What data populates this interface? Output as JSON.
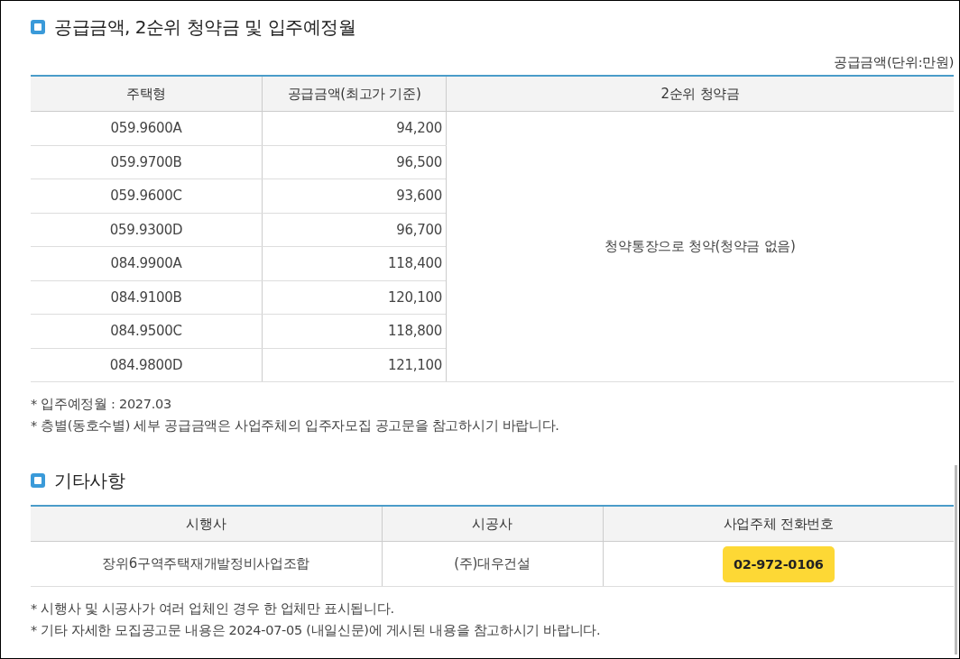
{
  "supply_section": {
    "title": "공급금액, 2순위 청약금 및 입주예정월",
    "unit_note": "공급금액(단위:만원)",
    "columns": [
      "주택형",
      "공급금액(최고가 기준)",
      "2순위 청약금"
    ],
    "rows": [
      {
        "type": "059.9600A",
        "price": "94,200"
      },
      {
        "type": "059.9700B",
        "price": "96,500"
      },
      {
        "type": "059.9600C",
        "price": "93,600"
      },
      {
        "type": "059.9300D",
        "price": "96,700"
      },
      {
        "type": "084.9900A",
        "price": "118,400"
      },
      {
        "type": "084.9100B",
        "price": "120,100"
      },
      {
        "type": "084.9500C",
        "price": "118,800"
      },
      {
        "type": "084.9800D",
        "price": "121,100"
      }
    ],
    "deposit": "청약통장으로 청약(청약금 없음)",
    "notes": [
      "* 입주예정월 : 2027.03",
      "* 층별(동호수별) 세부 공급금액은 사업주체의 입주자모집 공고문을 참고하시기 바랍니다."
    ]
  },
  "other_section": {
    "title": "기타사항",
    "columns": [
      "시행사",
      "시공사",
      "사업주체 전화번호"
    ],
    "rows": [
      {
        "developer": "장위6구역주택재개발정비사업조합",
        "builder": "(주)대우건설",
        "phone": "02-972-0106"
      }
    ],
    "notes": [
      "* 시행사 및 시공사가 여러 업체인 경우 한 업체만 표시됩니다.",
      "* 기타 자세한 모집공고문 내용은 2024-07-05 (내일신문)에 게시된 내용을 참고하시기 바랍니다."
    ]
  }
}
